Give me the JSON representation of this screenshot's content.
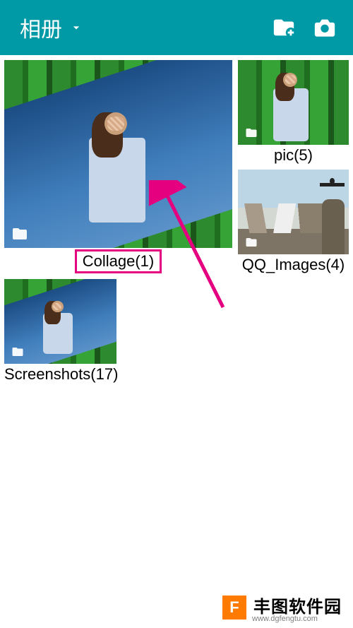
{
  "topbar": {
    "title": "相册",
    "new_folder_icon": "new-folder",
    "camera_icon": "camera"
  },
  "albums": [
    {
      "name": "Collage",
      "count": 1,
      "label": "Collage(1)",
      "highlighted": true
    },
    {
      "name": "pic",
      "count": 5,
      "label": "pic(5)",
      "highlighted": false
    },
    {
      "name": "QQ_Images",
      "count": 4,
      "label": "QQ_Images(4)",
      "highlighted": false
    },
    {
      "name": "Screenshots",
      "count": 17,
      "label": "Screenshots(17)",
      "highlighted": false
    }
  ],
  "annotation": {
    "arrow_color": "#e4007f"
  },
  "footer": {
    "logo_letter": "F",
    "brand": "丰图软件园",
    "url": "www.dgfengtu.com"
  }
}
